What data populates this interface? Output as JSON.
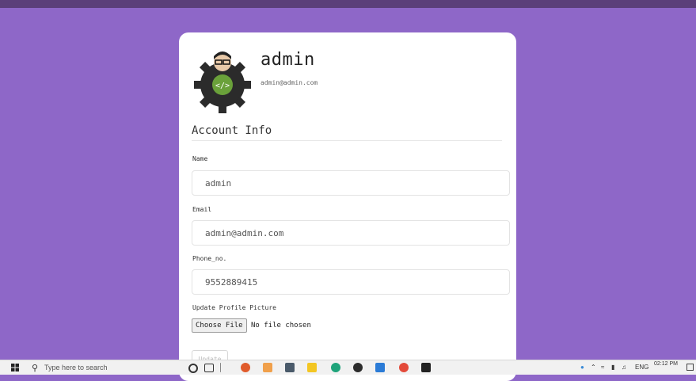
{
  "profile": {
    "name": "admin",
    "email": "admin@admin.com"
  },
  "section_title": "Account Info",
  "fields": {
    "name": {
      "label": "Name",
      "value": "admin"
    },
    "email": {
      "label": "Email",
      "value": "admin@admin.com"
    },
    "phone": {
      "label": "Phone_no.",
      "value": "9552889415"
    }
  },
  "upload": {
    "label": "Update Profile Picture",
    "button": "Choose File",
    "status": "No file chosen"
  },
  "update_button": "Update",
  "taskbar": {
    "search_placeholder": "Type here to search",
    "language": "ENG",
    "time": "02:12 PM",
    "date": ""
  },
  "colors": {
    "background": "#8e67c8",
    "card": "#ffffff"
  }
}
